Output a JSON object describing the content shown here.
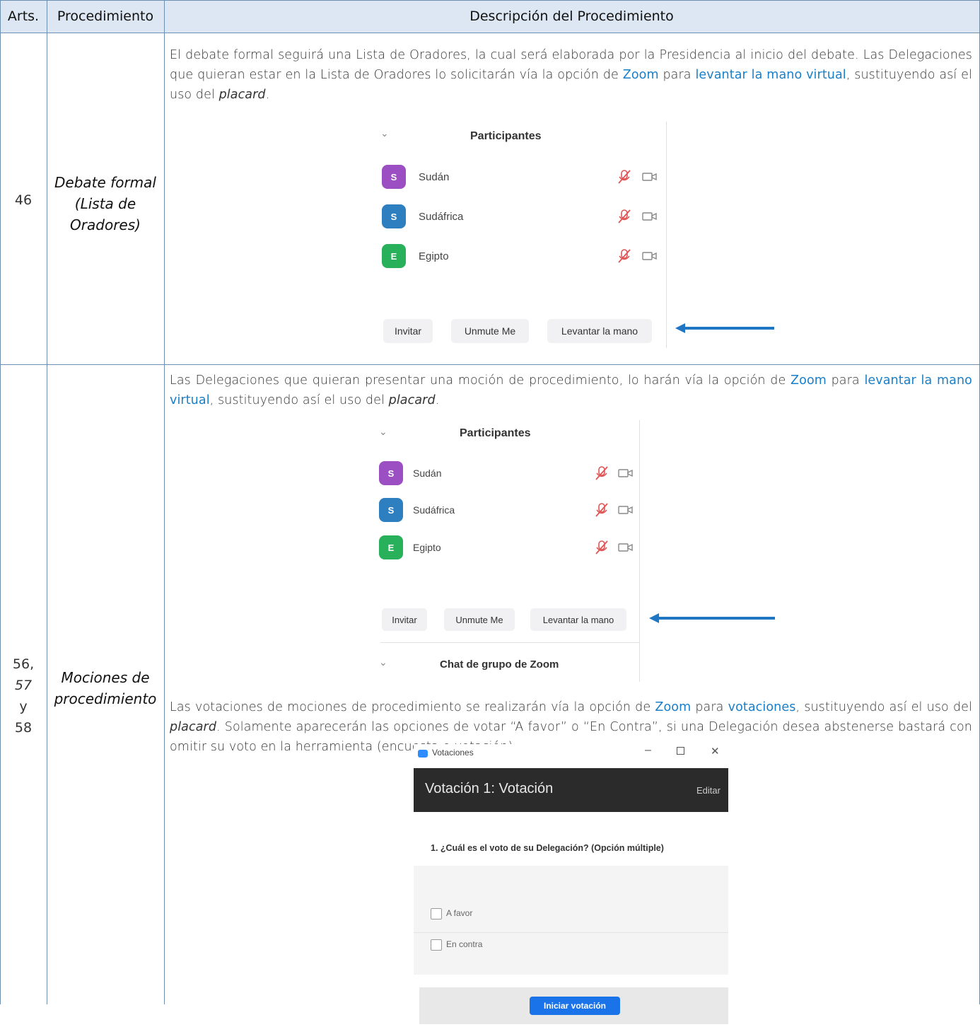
{
  "header": {
    "col1": "Arts.",
    "col2": "Procedimiento",
    "col3": "Descripción del Procedimiento"
  },
  "row1": {
    "arts": "46",
    "proc_lines": [
      "Debate formal",
      "(Lista de",
      "Oradores)"
    ],
    "desc": {
      "t1": "El debate formal seguirá una Lista de Oradores, la cual será elaborada por la Presidencia al inicio del debate. Las Delegaciones que quieran estar en la Lista de Oradores lo solicitarán vía la opción de ",
      "zoom": "Zoom",
      "t2": " para ",
      "hand": "levantar la mano virtual",
      "t3": ", sustituyendo así el uso del ",
      "placard": "placard",
      "t4": "."
    },
    "panel": {
      "title": "Participantes",
      "participants": [
        {
          "initial": "S",
          "name": "Sudán",
          "color": "#9b4fc2"
        },
        {
          "initial": "S",
          "name": "Sudáfrica",
          "color": "#2e7fc0"
        },
        {
          "initial": "E",
          "name": "Egipto",
          "color": "#28b15a"
        }
      ],
      "buttons": [
        "Invitar",
        "Unmute Me",
        "Levantar la mano"
      ]
    }
  },
  "row2": {
    "arts_lines": [
      "56,",
      "57",
      "y",
      "58"
    ],
    "proc_lines": [
      "Mociones de",
      "procedimiento"
    ],
    "desc1": {
      "t1": "Las Delegaciones que quieran presentar una moción de procedimiento, lo harán vía la opción de ",
      "zoom": "Zoom",
      "t2": " para ",
      "hand": "levantar la mano virtual",
      "t3": ", sustituyendo así el uso del ",
      "placard": "placard",
      "t4": "."
    },
    "panel": {
      "title": "Participantes",
      "participants": [
        {
          "initial": "S",
          "name": "Sudán",
          "color": "#9b4fc2"
        },
        {
          "initial": "S",
          "name": "Sudáfrica",
          "color": "#2e7fc0"
        },
        {
          "initial": "E",
          "name": "Egipto",
          "color": "#28b15a"
        }
      ],
      "buttons": [
        "Invitar",
        "Unmute Me",
        "Levantar la mano"
      ],
      "chat_title": "Chat de grupo de Zoom"
    },
    "desc2": {
      "t1": "Las votaciones de mociones de procedimiento se realizarán vía la opción de ",
      "zoom": "Zoom",
      "t2": " para ",
      "votaciones": "votaciones",
      "t3": ", sustituyendo así el uso del ",
      "placard": "placard",
      "t4": ". Solamente aparecerán las opciones de votar “A favor” o “En Contra”, si una Delegación desea abstenerse bastará con omitir su voto en la herramienta (encuesta o votación)."
    },
    "poll": {
      "window_title": "Votaciones",
      "heading": "Votación 1: Votación",
      "edit": "Editar",
      "question": "1. ¿Cuál es el voto de su Delegación? (Opción múltiple)",
      "options": [
        "A favor",
        "En contra"
      ],
      "start_button": "Iniciar votación"
    }
  },
  "colors": {
    "header_bg": "#dce7f3",
    "grid": "#6d8fb0",
    "link_blue": "#1a7fc8",
    "arrow_blue": "#1f77c4",
    "poll_button": "#1a73e8"
  }
}
